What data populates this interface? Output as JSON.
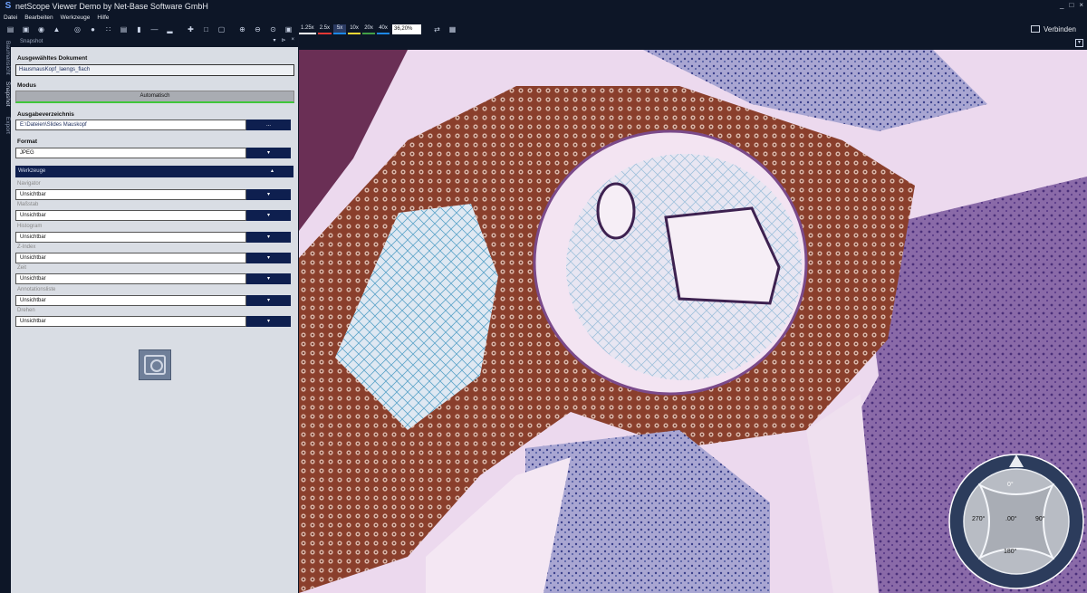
{
  "app": {
    "title": "netScope Viewer Demo by Net-Base Software GmbH",
    "logo_letter": "S",
    "window_controls": [
      "_",
      "□",
      "×"
    ]
  },
  "menu": [
    "Datei",
    "Bearbeiten",
    "Werkzeuge",
    "Hilfe"
  ],
  "toolbar": {
    "zoom_levels": [
      {
        "label": "1.25x",
        "color": "#ffffff"
      },
      {
        "label": "2.5x",
        "color": "#e53935"
      },
      {
        "label": "5x",
        "color": "#1e88e5"
      },
      {
        "label": "10x",
        "color": "#fdd835"
      },
      {
        "label": "20x",
        "color": "#43a047"
      },
      {
        "label": "40x",
        "color": "#1e88e5"
      }
    ],
    "zoom_value": "36,20%",
    "connect_label": "Verbinden"
  },
  "side_tabs": [
    "Baumansicht",
    "Snapshot",
    "Export"
  ],
  "panel": {
    "title": "Snapshot",
    "selected_doc_label": "Ausgewähltes Dokument",
    "selected_doc_value": "HausmausKopf_laengs_flach",
    "mode_label": "Modus",
    "mode_value": "Automatisch",
    "output_dir_label": "Ausgabeverzeichnis",
    "output_dir_value": "E:\\Dateien\\Slides Mauskopf",
    "output_dir_button": "...",
    "format_label": "Format",
    "format_value": "JPEG",
    "tools_label": "Werkzeuge",
    "tools": [
      {
        "label": "Navigator",
        "value": "Unsichtbar"
      },
      {
        "label": "Maßstab",
        "value": "Unsichtbar"
      },
      {
        "label": "Histogram",
        "value": "Unsichtbar"
      },
      {
        "label": "Z-Index",
        "value": "Unsichtbar"
      },
      {
        "label": "Zeit",
        "value": "Unsichtbar"
      },
      {
        "label": "Annotationsliste",
        "value": "Unsichtbar"
      },
      {
        "label": "Drehen",
        "value": "Unsichtbar"
      }
    ]
  },
  "compass": {
    "top": "0°",
    "right": "90°",
    "bottom": "180°",
    "left": "270°",
    "center": ".00°"
  }
}
